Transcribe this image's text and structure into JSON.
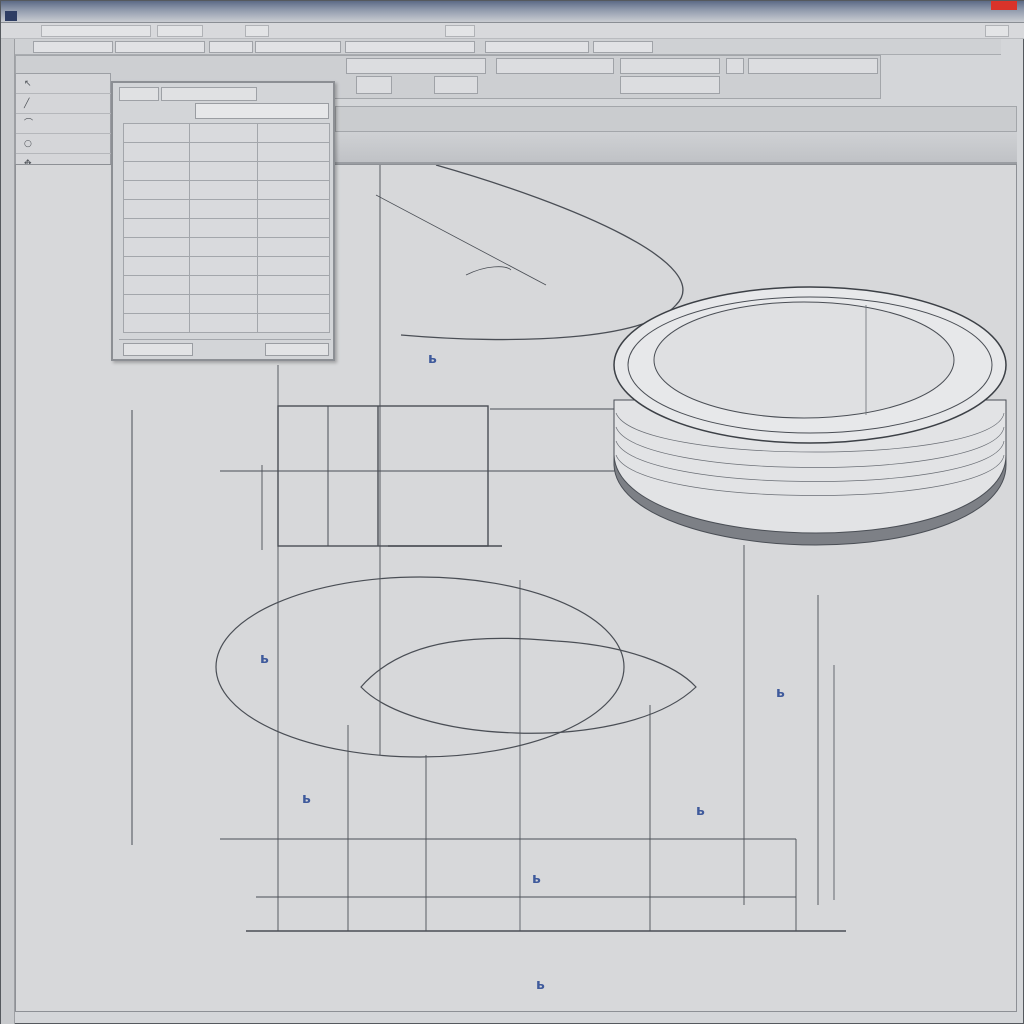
{
  "window": {
    "title": "",
    "close_label": ""
  },
  "menu": {
    "items": [
      "",
      "",
      "",
      "",
      ""
    ]
  },
  "toolbar_top": {
    "fields": [
      "",
      "",
      "",
      "",
      "",
      "",
      ""
    ]
  },
  "toolbar_second": {
    "cells": [
      "",
      "",
      "",
      "",
      "",
      "",
      "",
      ""
    ]
  },
  "toolbar_third": {
    "link_label": ""
  },
  "status_strip": {
    "text": ""
  },
  "sidebar": {
    "items": [
      {
        "icon": "select-icon",
        "label": ""
      },
      {
        "icon": "line-icon",
        "label": ""
      },
      {
        "icon": "arc-icon",
        "label": ""
      },
      {
        "icon": "circle-icon",
        "label": ""
      },
      {
        "icon": "move-icon",
        "label": ""
      },
      {
        "icon": "trim-icon",
        "label": ""
      }
    ],
    "footer": ""
  },
  "properties_panel": {
    "tabs": [
      "",
      ""
    ],
    "search_value": "",
    "rows": [
      [
        "",
        "",
        ""
      ],
      [
        "",
        "",
        ""
      ],
      [
        "",
        "",
        ""
      ],
      [
        "",
        "",
        ""
      ],
      [
        "",
        "",
        ""
      ],
      [
        "",
        "",
        ""
      ],
      [
        "",
        "",
        ""
      ],
      [
        "",
        "",
        ""
      ],
      [
        "",
        "",
        ""
      ],
      [
        "",
        "",
        ""
      ],
      [
        "",
        "",
        ""
      ]
    ],
    "ok_label": "",
    "cancel_label": ""
  },
  "colors": {
    "window_bg": "#d4d6d9",
    "canvas_bg": "#d7d8da",
    "line": "#4a4e55",
    "annotation": "#3f5a9c",
    "close": "#d9332a"
  }
}
